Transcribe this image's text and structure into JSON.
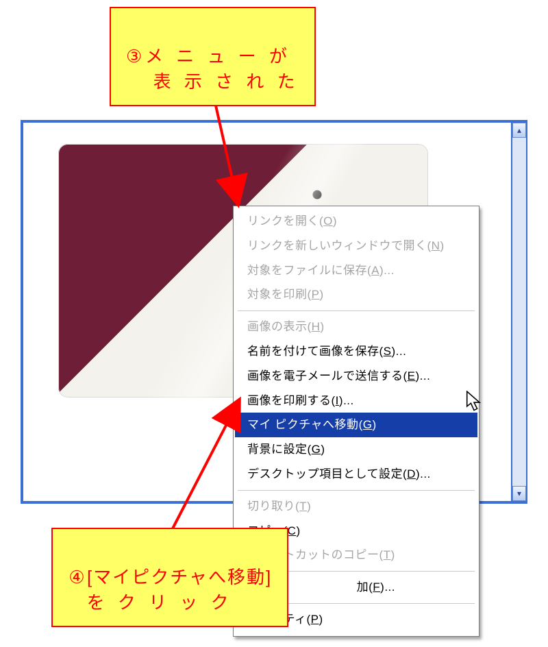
{
  "annotation_top": {
    "number": "③",
    "line1": "メ ニ ュ ー が",
    "line2": "表 示 さ れ た"
  },
  "annotation_bottom": {
    "number": "④",
    "line1": "[マイピクチャへ移動]",
    "line2": "を ク リ ッ ク"
  },
  "menu": {
    "open_link": {
      "label": "リンクを開く",
      "accel": "O",
      "disabled": true
    },
    "open_new_win": {
      "label": "リンクを新しいウィンドウで開く",
      "accel": "N",
      "disabled": true
    },
    "save_target": {
      "label": "対象をファイルに保存",
      "accel": "A",
      "ellipsis": true,
      "disabled": true
    },
    "print_target": {
      "label": "対象を印刷",
      "accel": "P",
      "disabled": true
    },
    "show_image": {
      "label": "画像の表示",
      "accel": "H",
      "disabled": true
    },
    "save_image": {
      "label": "名前を付けて画像を保存",
      "accel": "S",
      "ellipsis": true
    },
    "email_image": {
      "label": "画像を電子メールで送信する",
      "accel": "E",
      "ellipsis": true
    },
    "print_image": {
      "label": "画像を印刷する",
      "accel": "I",
      "ellipsis": true
    },
    "goto_mypic": {
      "label": "マイ ピクチャへ移動",
      "accel": "G",
      "selected": true
    },
    "set_wallpaper": {
      "label": "背景に設定",
      "accel": "G"
    },
    "set_desktop_item": {
      "label": "デスクトップ項目として設定",
      "accel": "D",
      "ellipsis": true
    },
    "cut": {
      "label": "切り取り",
      "accel": "T",
      "disabled": true
    },
    "copy": {
      "label": "コピー",
      "accel": "C"
    },
    "copy_shortcut": {
      "label": "ショートカットのコピー",
      "accel": "T",
      "disabled": true
    },
    "add_fav": {
      "label": "加",
      "accel": "F",
      "ellipsis": true
    },
    "properties": {
      "label": "プロパティ",
      "accel": "P"
    }
  }
}
